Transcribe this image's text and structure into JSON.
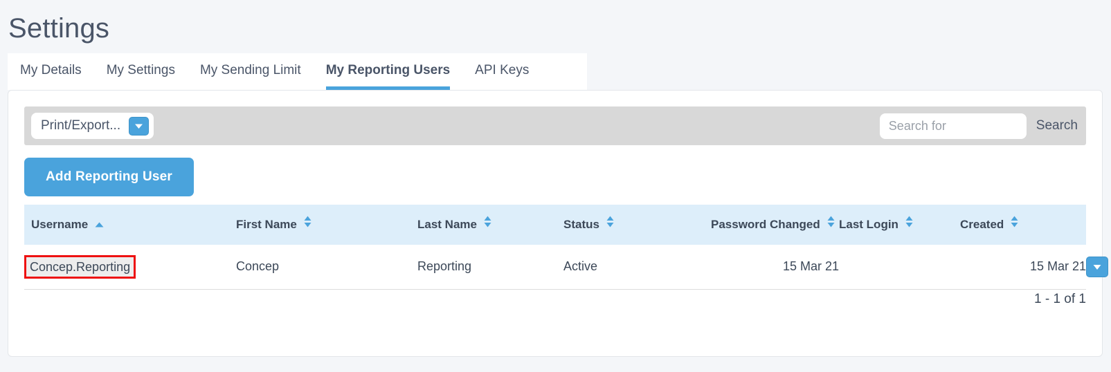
{
  "page": {
    "title": "Settings"
  },
  "tabs": [
    {
      "label": "My Details",
      "active": false
    },
    {
      "label": "My Settings",
      "active": false
    },
    {
      "label": "My Sending Limit",
      "active": false
    },
    {
      "label": "My Reporting Users",
      "active": true
    },
    {
      "label": "API Keys",
      "active": false
    }
  ],
  "toolbar": {
    "export_label": "Print/Export...",
    "export_icon": "chevron-down-icon",
    "search_placeholder": "Search for",
    "search_value": "",
    "search_button_label": "Search"
  },
  "actions": {
    "add_user_label": "Add Reporting User"
  },
  "table": {
    "columns": [
      {
        "label": "Username",
        "sort": "asc"
      },
      {
        "label": "First Name",
        "sort": "none"
      },
      {
        "label": "Last Name",
        "sort": "none"
      },
      {
        "label": "Status",
        "sort": "none"
      },
      {
        "label": "Password Changed",
        "sort": "none"
      },
      {
        "label": "Last Login",
        "sort": "none"
      },
      {
        "label": "Created",
        "sort": "none"
      }
    ],
    "rows": [
      {
        "username": "Concep.Reporting",
        "first_name": "Concep",
        "last_name": "Reporting",
        "status": "Active",
        "password_changed": "15 Mar 21",
        "last_login": "",
        "created": "15 Mar 21",
        "row_action_icon": "chevron-down-icon"
      }
    ]
  },
  "pagination": {
    "range_label": "1 - 1 of 1"
  },
  "colors": {
    "accent": "#4aa3dc",
    "page_background": "#f4f6f9",
    "toolbar_background": "#d8d8d8",
    "table_header_background": "#ddeefa",
    "highlight_border": "#ee1111",
    "text": "#3c4858"
  }
}
